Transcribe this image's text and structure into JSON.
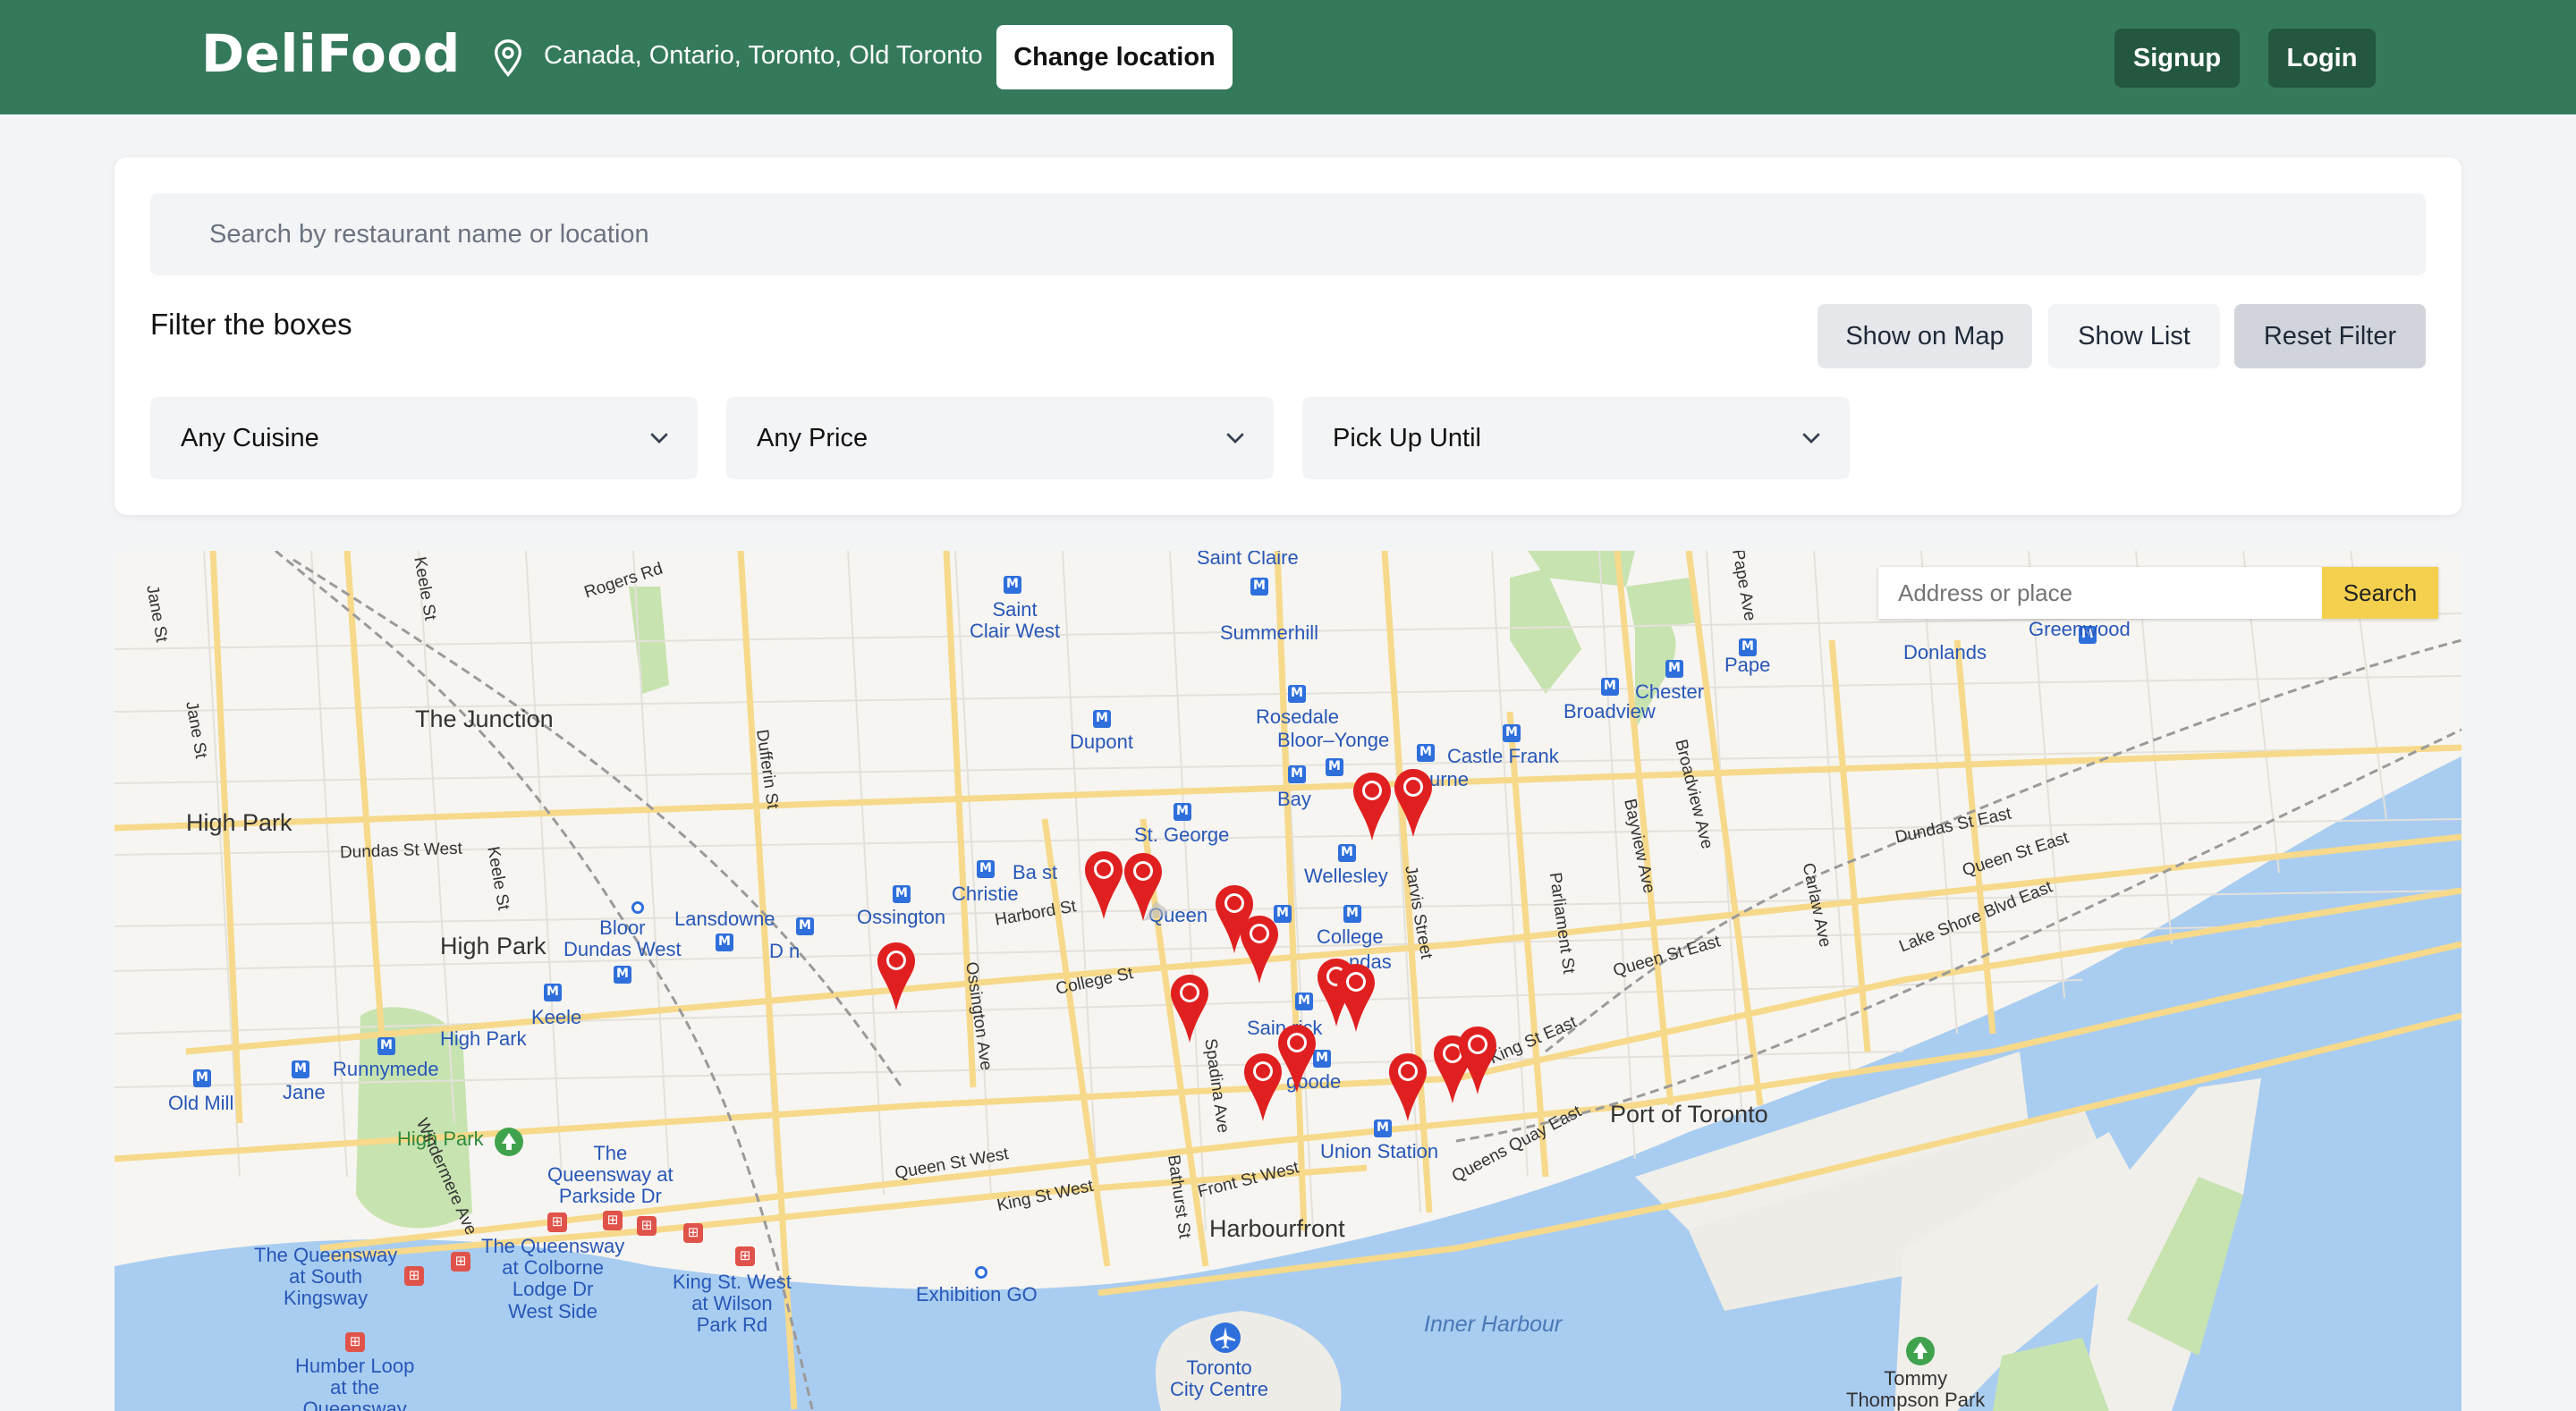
{
  "header": {
    "logo": "DeliFood",
    "location_icon": "map-pin-icon",
    "location_text": "Canada, Ontario, Toronto, Old Toronto",
    "change_location_label": "Change location",
    "signup_label": "Signup",
    "login_label": "Login",
    "brand_color": "#34795a"
  },
  "filters": {
    "search_placeholder": "Search by restaurant name or location",
    "title": "Filter the boxes",
    "show_on_map_label": "Show on Map",
    "show_list_label": "Show List",
    "reset_label": "Reset Filter",
    "cuisine_value": "Any Cuisine",
    "price_value": "Any Price",
    "pickup_value": "Pick Up Until",
    "chevron_icon": "chevron-down-icon"
  },
  "map": {
    "search_placeholder": "Address or place",
    "search_button": "Search",
    "pin_color": "#e02020",
    "restaurant_pin_count": 15,
    "labels": {
      "junction": "The Junction",
      "high_park_1": "High Park",
      "high_park_2": "High Park",
      "high_park_station": "High Park",
      "high_park_poi": "High Park",
      "saint_claire": "Saint Claire",
      "saint_clair_west": "Saint\nClair West",
      "summerhill": "Summerhill",
      "rosedale": "Rosedale",
      "bloor_yonge": "Bloor–Yonge",
      "castle_frank": "Castle Frank",
      "castle_frank_2": "urne",
      "dupont": "Dupont",
      "bay": "Bay",
      "st_george": "St. George",
      "wellesley": "Wellesley",
      "christie": "Christie",
      "bathurst": "Ba   st",
      "ossington": "Ossington",
      "lansdowne": "Lansdowne",
      "dufferin": "D    n",
      "bloor_dundas_west": "Bloor\nDundas West",
      "keele": "Keele",
      "runnymede": "Runnymede",
      "jane": "Jane",
      "old_mill": "Old Mill",
      "queen_station": "Queen",
      "college_station": "College",
      "dundas_station": "ndas",
      "saint_patrick": "Sain   rick",
      "osgoode": "  goode",
      "union_station": "Union Station",
      "port_of_toronto": "Port of Toronto",
      "harbourfront": "Harbourfront",
      "inner_harbour": "Inner Harbour",
      "exhibition_go": "Exhibition GO",
      "toronto_city_centre": "Toronto\nCity Centre",
      "tommy_thompson": "Tommy\nThompson Park",
      "greenwood": "Greenwood",
      "donlands": "Donlands",
      "pape": "Pape",
      "chester": "Chester",
      "broadview": "Broadview",
      "queensway_parkside": "The\nQueensway at\nParkside Dr",
      "queensway_colborne": "The Queensway\nat Colborne\nLodge Dr\nWest Side",
      "queensway_south_kingsway": "The Queensway\nat South\nKingsway",
      "king_wilson_park": "King St. West\nat Wilson\nPark Rd",
      "humber_loop": "Humber Loop\nat the\nQueensway",
      "rogers_rd": "Rogers Rd",
      "keele_st": "Keele St",
      "jane_st_1": "Jane St",
      "jane_st_2": "Jane St",
      "dundas_st_west": "Dundas St West",
      "keele_st_2": "Keele St",
      "dufferin_st": "Dufferin St",
      "harbord_st": "Harbord St",
      "college_st": "College St",
      "ossington_ave": "Ossington Ave",
      "spadina_ave": "Spadina Ave",
      "bathurst_st": "Bathurst St",
      "queen_st_west": "Queen St West",
      "king_st_west": "King St West",
      "front_st_west": "Front St West",
      "jarvis_st": "Jarvis Street",
      "parliament_st": "Parliament St",
      "bayview_ave": "Bayview Ave",
      "broadview_ave": "Broadview Ave",
      "carlaw_ave": "Carlaw Ave",
      "pape_ave": "Pape Ave",
      "dundas_st_east": "Dundas St East",
      "queen_st_east_1": "Queen St East",
      "queen_st_east_2": "Queen St East",
      "lake_shore_blvd": "Lake Shore Blvd East",
      "king_st_east": "King St East",
      "queens_quay_east": "Queens Quay East",
      "windermere_ave": "Windermere Ave"
    }
  }
}
